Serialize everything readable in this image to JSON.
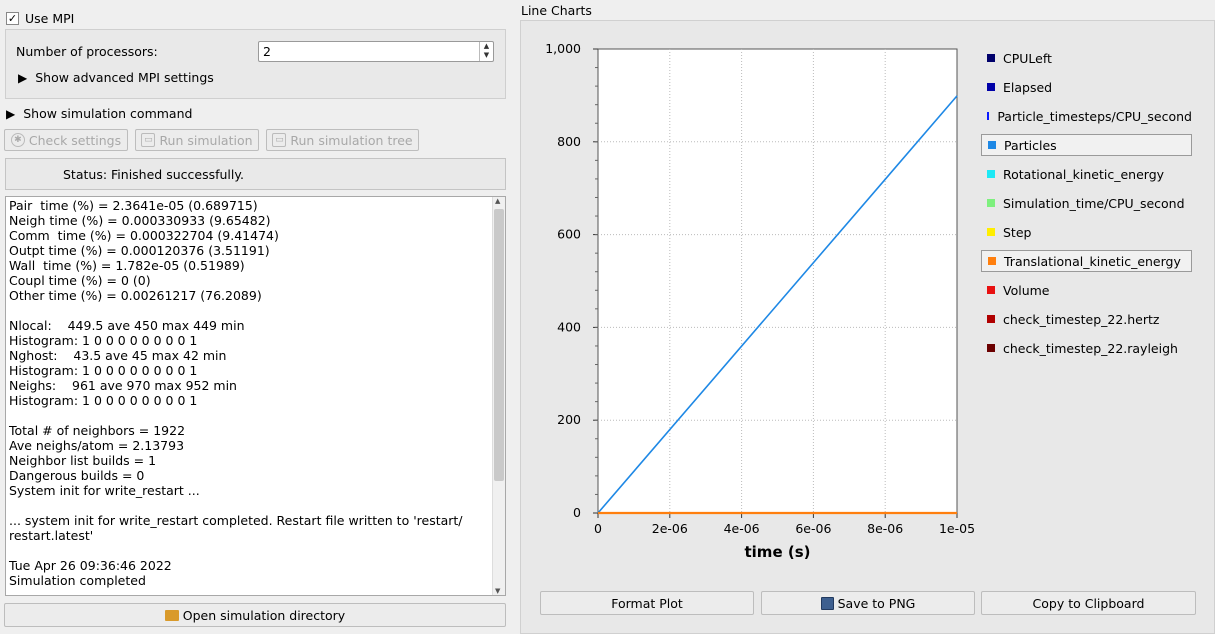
{
  "mpi": {
    "use_mpi_label": "Use MPI",
    "checked_mark": "✓",
    "processors_label": "Number of processors:",
    "processors_value": "2",
    "advanced_label": "Show advanced MPI settings"
  },
  "simulation_command_label": "Show simulation command",
  "buttons": {
    "check_settings": "Check settings",
    "run_simulation": "Run simulation",
    "run_simulation_tree": "Run simulation tree",
    "open_directory": "Open simulation directory"
  },
  "status_text": "Status: Finished successfully.",
  "log_lines": [
    "Pair  time (%) = 2.3641e-05 (0.689715)",
    "Neigh time (%) = 0.000330933 (9.65482)",
    "Comm  time (%) = 0.000322704 (9.41474)",
    "Outpt time (%) = 0.000120376 (3.51191)",
    "Wall  time (%) = 1.782e-05 (0.51989)",
    "Coupl time (%) = 0 (0)",
    "Other time (%) = 0.00261217 (76.2089)",
    "",
    "Nlocal:    449.5 ave 450 max 449 min",
    "Histogram: 1 0 0 0 0 0 0 0 0 1",
    "Nghost:    43.5 ave 45 max 42 min",
    "Histogram: 1 0 0 0 0 0 0 0 0 1",
    "Neighs:    961 ave 970 max 952 min",
    "Histogram: 1 0 0 0 0 0 0 0 0 1",
    "",
    "Total # of neighbors = 1922",
    "Ave neighs/atom = 2.13793",
    "Neighbor list builds = 1",
    "Dangerous builds = 0",
    "System init for write_restart ...",
    "",
    "... system init for write_restart completed. Restart file written to 'restart/",
    "restart.latest'",
    "",
    "Tue Apr 26 09:36:46 2022",
    "Simulation completed"
  ],
  "right": {
    "panel_title": "Line Charts",
    "format_plot": "Format Plot",
    "save_png": "Save to PNG",
    "copy_clipboard": "Copy to Clipboard"
  },
  "legend": [
    {
      "label": "CPULeft",
      "color": "#00006b",
      "selected": false
    },
    {
      "label": "Elapsed",
      "color": "#0000a8",
      "selected": false
    },
    {
      "label": "Particle_timesteps/CPU_second",
      "color": "#0a1aff",
      "selected": false
    },
    {
      "label": "Particles",
      "color": "#1e88e5",
      "selected": true
    },
    {
      "label": "Rotational_kinetic_energy",
      "color": "#1de9f5",
      "selected": false
    },
    {
      "label": "Simulation_time/CPU_second",
      "color": "#7ef07e",
      "selected": false
    },
    {
      "label": "Step",
      "color": "#ffee00",
      "selected": false
    },
    {
      "label": "Translational_kinetic_energy",
      "color": "#ff7f0e",
      "selected": true
    },
    {
      "label": "Volume",
      "color": "#e81010",
      "selected": false
    },
    {
      "label": "check_timestep_22.hertz",
      "color": "#b00000",
      "selected": false
    },
    {
      "label": "check_timestep_22.rayleigh",
      "color": "#6b0000",
      "selected": false
    }
  ],
  "chart_data": {
    "type": "line",
    "xlabel": "time (s)",
    "ylabel": "",
    "xlim": [
      0,
      1e-05
    ],
    "ylim": [
      0,
      1000
    ],
    "x_ticks": [
      0,
      2e-06,
      4e-06,
      6e-06,
      8e-06,
      1e-05
    ],
    "x_tick_labels": [
      "0",
      "2e-06",
      "4e-06",
      "6e-06",
      "8e-06",
      "1e-05"
    ],
    "y_ticks": [
      0,
      200,
      400,
      600,
      800,
      1000
    ],
    "y_tick_labels": [
      "0",
      "200",
      "400",
      "600",
      "800",
      "1,000"
    ],
    "grid": true,
    "series": [
      {
        "name": "Particles",
        "color": "#1e88e5",
        "x": [
          0,
          1e-05
        ],
        "y": [
          0,
          899
        ]
      },
      {
        "name": "Translational_kinetic_energy",
        "color": "#ff7f0e",
        "x": [
          0,
          1e-05
        ],
        "y": [
          0,
          0
        ]
      }
    ]
  }
}
